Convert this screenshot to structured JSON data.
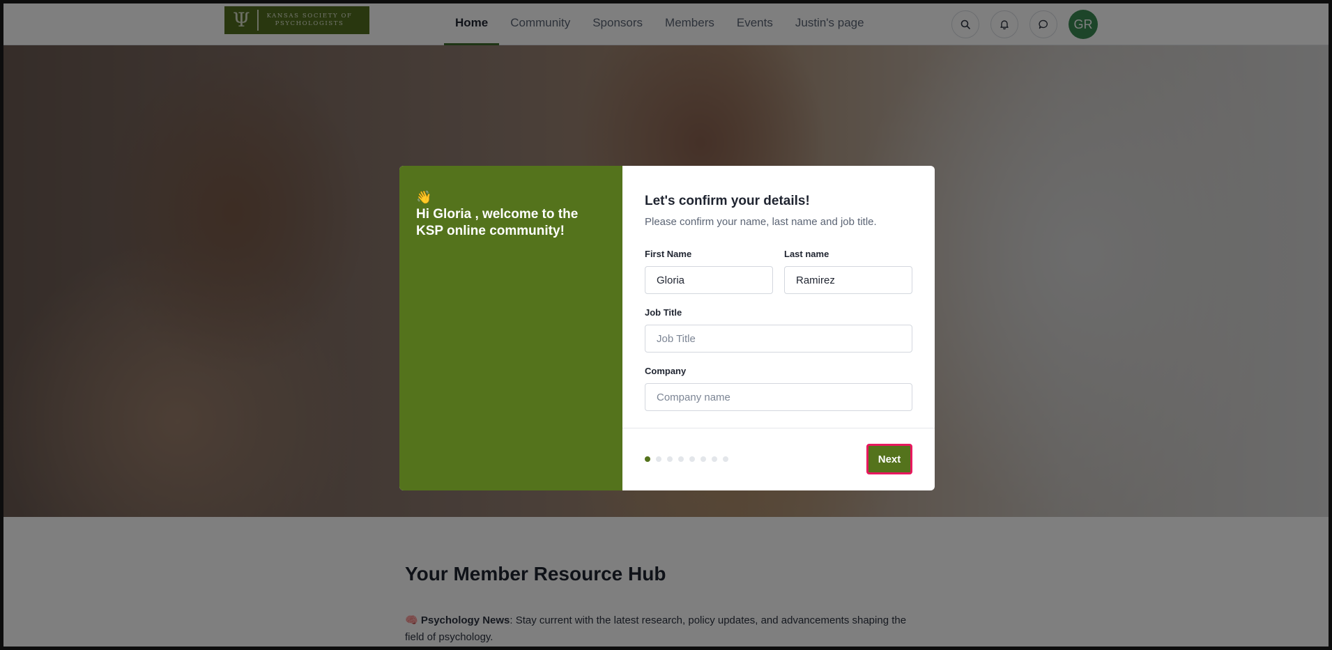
{
  "header": {
    "logo_text_line1": "KANSAS SOCIETY OF",
    "logo_text_line2": "PSYCHOLOGISTS",
    "logo_symbol": "Ψ",
    "nav": [
      "Home",
      "Community",
      "Sponsors",
      "Members",
      "Events",
      "Justin's page"
    ],
    "active_nav": "Home",
    "avatar_initials": "GR"
  },
  "modal": {
    "wave_emoji": "👋",
    "welcome": "Hi Gloria , welcome to the KSP online community!",
    "title": "Let's confirm your details!",
    "subtitle": "Please confirm your name, last name and job title.",
    "first_name_label": "First Name",
    "first_name_value": "Gloria",
    "last_name_label": "Last name",
    "last_name_value": "Ramirez",
    "job_title_label": "Job Title",
    "job_title_placeholder": "Job Title",
    "company_label": "Company",
    "company_placeholder": "Company name",
    "step_total": 8,
    "step_current": 1,
    "next_label": "Next"
  },
  "content": {
    "hub_title": "Your Member Resource Hub",
    "news_emoji": "🧠",
    "news_bold": "Psychology News",
    "news_text": ": Stay current with the latest research, policy updates, and advancements shaping the field of psychology."
  },
  "colors": {
    "brand_green": "#54731c",
    "avatar_green": "#3a8a53",
    "focus_outline": "#e8185f"
  }
}
